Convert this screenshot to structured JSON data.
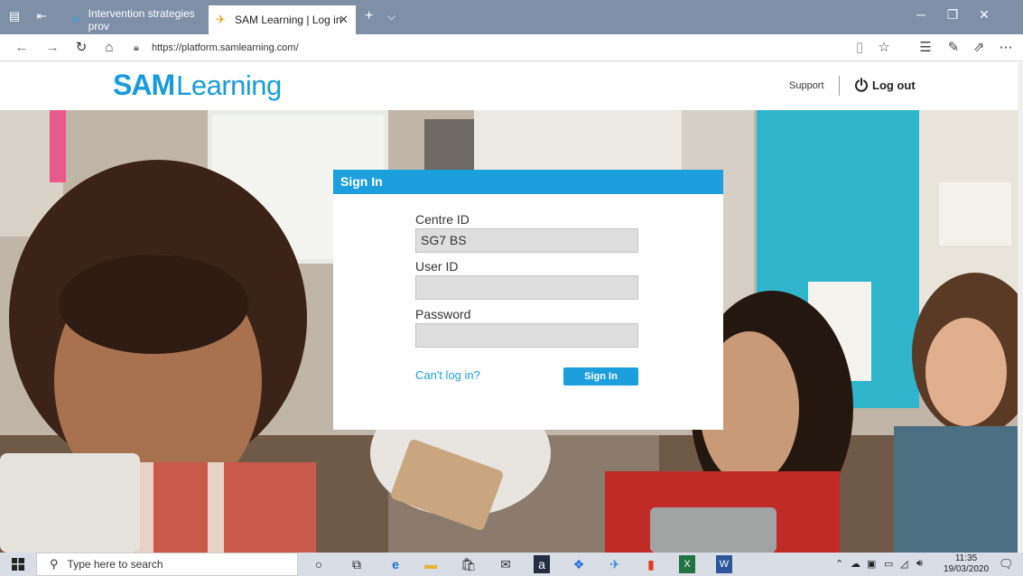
{
  "browser": {
    "tabs": [
      {
        "title": "Intervention strategies prov",
        "active": false
      },
      {
        "title": "SAM Learning | Log in",
        "active": true
      }
    ],
    "url": "https://platform.samlearning.com/"
  },
  "header": {
    "logo_bold": "SAM",
    "logo_rest": "Learning",
    "support_label": "Support",
    "logout_label": "Log out"
  },
  "signin": {
    "title": "Sign In",
    "centre_id_label": "Centre ID",
    "centre_id_value": "SG7 BS",
    "user_id_label": "User ID",
    "user_id_value": "",
    "password_label": "Password",
    "password_value": "",
    "cant_login_label": "Can't log in?",
    "submit_label": "Sign In"
  },
  "taskbar": {
    "search_placeholder": "Type here to search",
    "time": "11:35",
    "date": "19/03/2020"
  },
  "colors": {
    "brand_blue": "#1c9fdc",
    "tabstrip": "#7f8fa8",
    "taskbar": "#d9dde6"
  }
}
